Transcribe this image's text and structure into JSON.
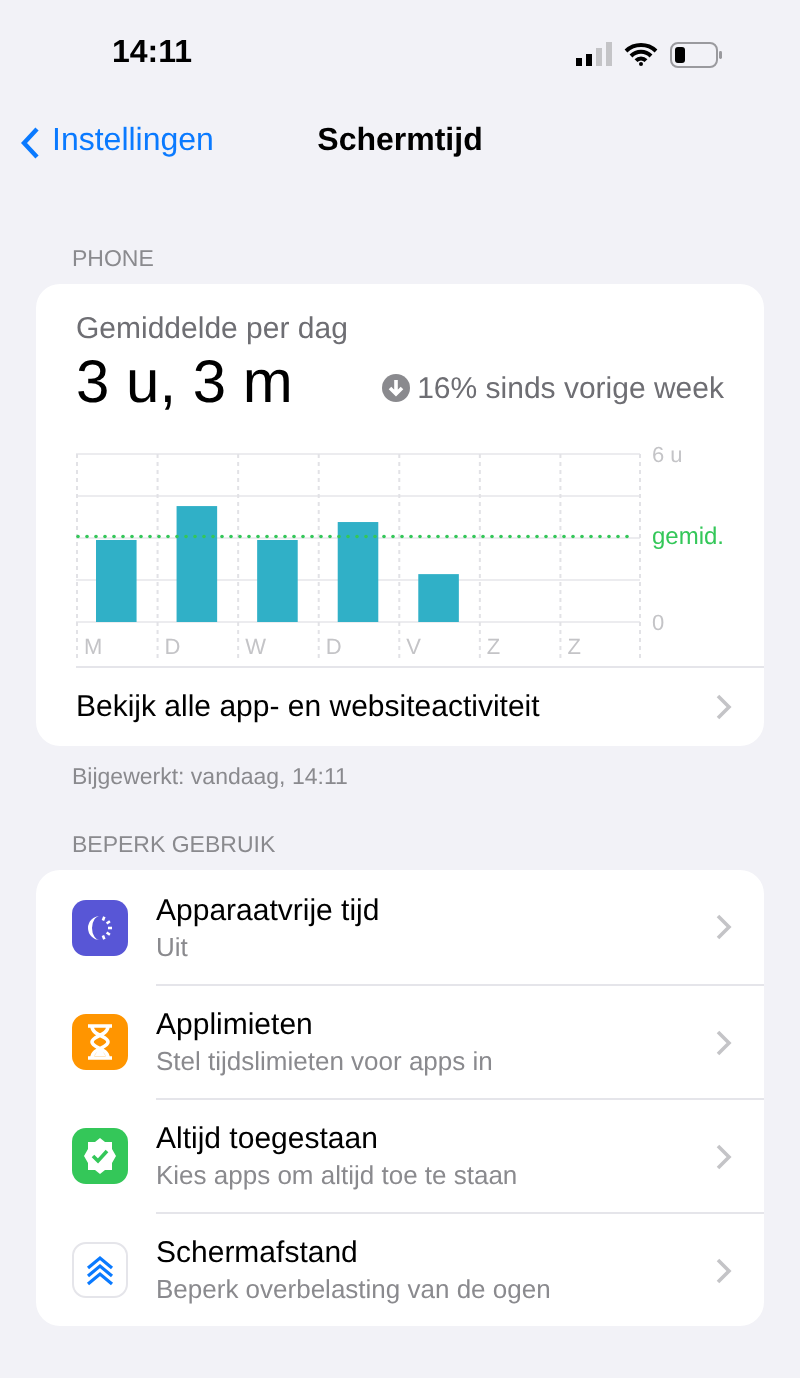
{
  "status_bar": {
    "time": "14:11"
  },
  "nav": {
    "back": "Instellingen",
    "title": "Schermtijd"
  },
  "device_header": "PHONE",
  "summary": {
    "label": "Gemiddelde per dag",
    "total": "3 u, 3 m",
    "change": "16% sinds vorige week",
    "chart_data": {
      "type": "bar",
      "categories": [
        "M",
        "D",
        "W",
        "D",
        "V",
        "Z",
        "Z"
      ],
      "series": [
        {
          "color": "#30b0c7",
          "values": [
            2.93,
            4.14,
            2.93,
            3.57,
            1.71,
            0,
            0
          ]
        }
      ],
      "ylim": [
        0,
        6
      ],
      "yticks": [
        {
          "value": 0,
          "label": "0"
        },
        {
          "value": 6,
          "label": "6 u"
        }
      ],
      "ref_lines": [
        {
          "label": "gemid.",
          "color": "#34c759"
        }
      ]
    },
    "link": "Bekijk alle app- en websiteactiviteit"
  },
  "updated": "Bijgewerkt: vandaag, 14:11",
  "limits_header": "BEPERK GEBRUIK",
  "limits": [
    {
      "title": "Apparaatvrije tijd",
      "subtitle": "Uit"
    },
    {
      "title": "Applimieten",
      "subtitle": "Stel tijdslimieten voor apps in"
    },
    {
      "title": "Altijd toegestaan",
      "subtitle": "Kies apps om altijd toe te staan"
    },
    {
      "title": "Schermafstand",
      "subtitle": "Beperk overbelasting van de ogen"
    }
  ]
}
